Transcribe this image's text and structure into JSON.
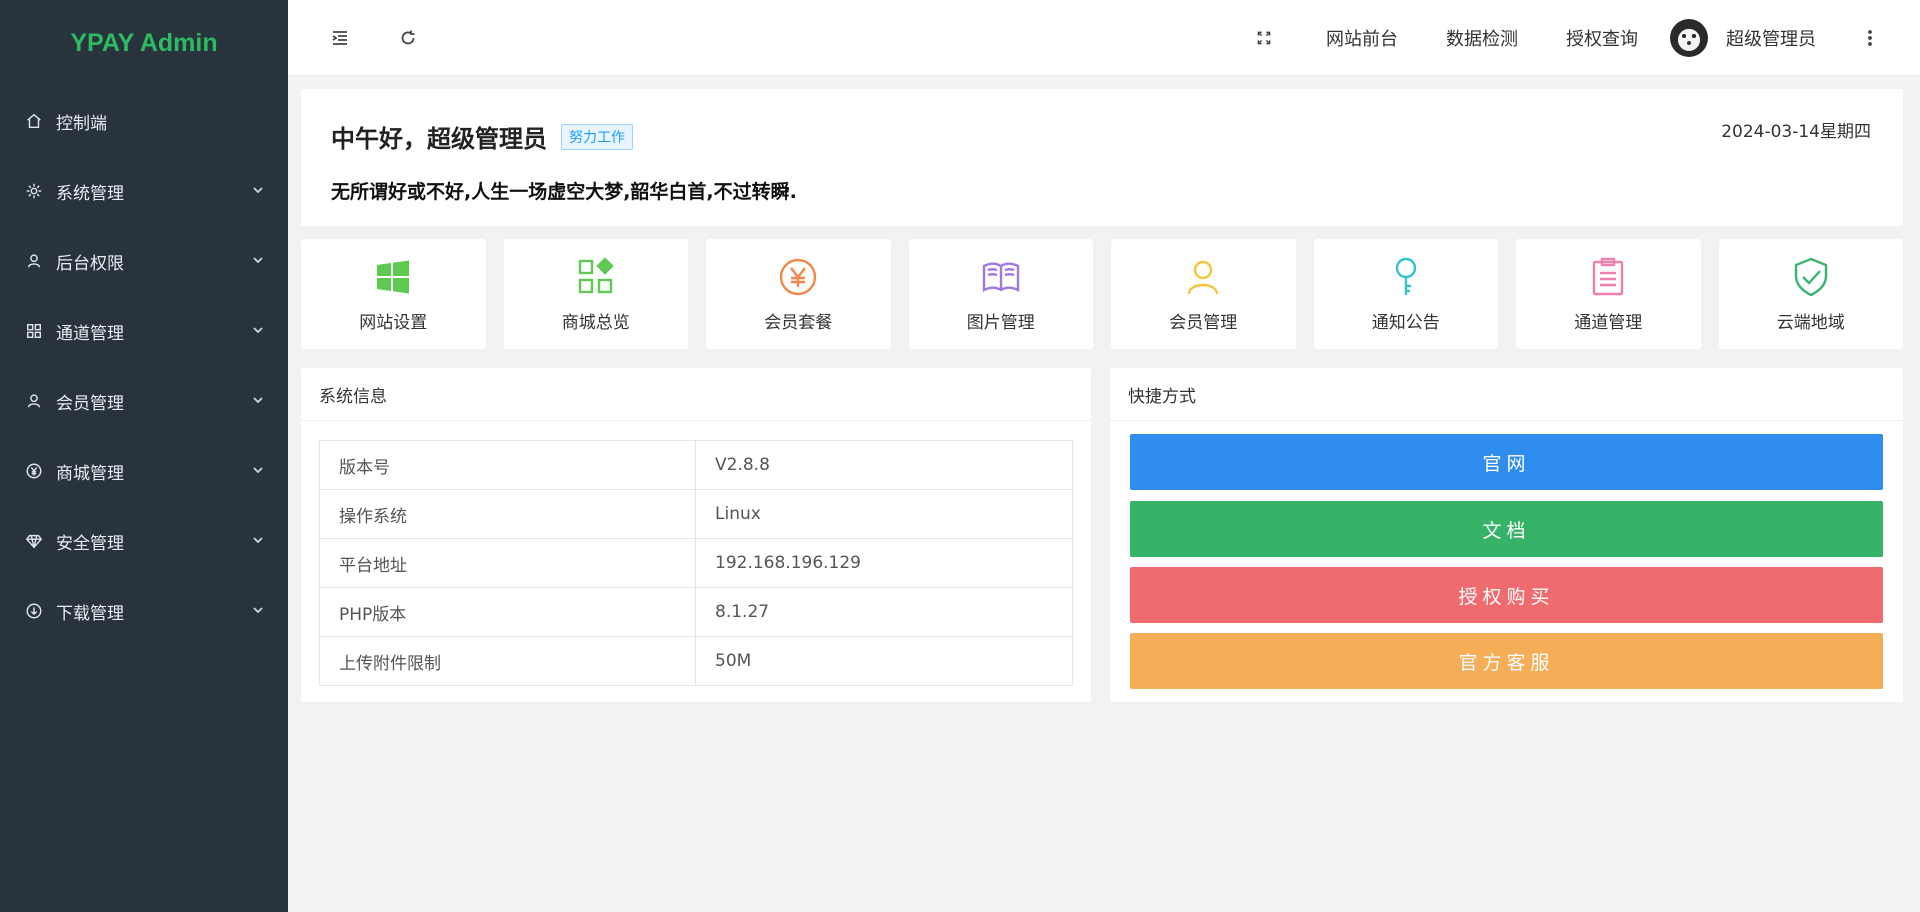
{
  "sidebar": {
    "brand": "YPAY Admin",
    "items": [
      {
        "label": "控制端",
        "icon": "home-icon"
      },
      {
        "label": "系统管理",
        "icon": "gear-icon"
      },
      {
        "label": "后台权限",
        "icon": "user-icon"
      },
      {
        "label": "通道管理",
        "icon": "apps-icon"
      },
      {
        "label": "会员管理",
        "icon": "user-icon"
      },
      {
        "label": "商城管理",
        "icon": "yen-icon"
      },
      {
        "label": "安全管理",
        "icon": "diamond-icon"
      },
      {
        "label": "下载管理",
        "icon": "download-icon"
      }
    ]
  },
  "header": {
    "links": [
      "网站前台",
      "数据检测",
      "授权查询"
    ],
    "user_name": "超级管理员"
  },
  "welcome": {
    "greeting": "中午好，超级管理员",
    "tag": "努力工作",
    "date": "2024-03-14星期四",
    "quote": "无所谓好或不好,人生一场虚空大梦,韶华白首,不过转瞬."
  },
  "quick_tiles": [
    {
      "label": "网站设置",
      "icon": "windows-icon",
      "color": "#5fc952"
    },
    {
      "label": "商城总览",
      "icon": "grid-icon",
      "color": "#5fc952"
    },
    {
      "label": "会员套餐",
      "icon": "yen-circle-icon",
      "color": "#f2874b"
    },
    {
      "label": "图片管理",
      "icon": "book-icon",
      "color": "#a377e0"
    },
    {
      "label": "会员管理",
      "icon": "user-icon",
      "color": "#f5c43c"
    },
    {
      "label": "通知公告",
      "icon": "key-icon",
      "color": "#33c3c9"
    },
    {
      "label": "通道管理",
      "icon": "clipboard-icon",
      "color": "#ef7fae"
    },
    {
      "label": "云端地域",
      "icon": "shield-check-icon",
      "color": "#3cb371"
    }
  ],
  "system_info": {
    "title": "系统信息",
    "rows": [
      {
        "key": "版本号",
        "value": "V2.8.8"
      },
      {
        "key": "操作系统",
        "value": "Linux"
      },
      {
        "key": "平台地址",
        "value": "192.168.196.129"
      },
      {
        "key": "PHP版本",
        "value": "8.1.27"
      },
      {
        "key": "上传附件限制",
        "value": "50M"
      }
    ]
  },
  "shortcuts": {
    "title": "快捷方式",
    "buttons": [
      {
        "label": "官网",
        "color": "#2e8ded"
      },
      {
        "label": "文档",
        "color": "#36b368"
      },
      {
        "label": "授权购买",
        "color": "#f06b6f"
      },
      {
        "label": "官方客服",
        "color": "#f5ad58"
      }
    ]
  }
}
